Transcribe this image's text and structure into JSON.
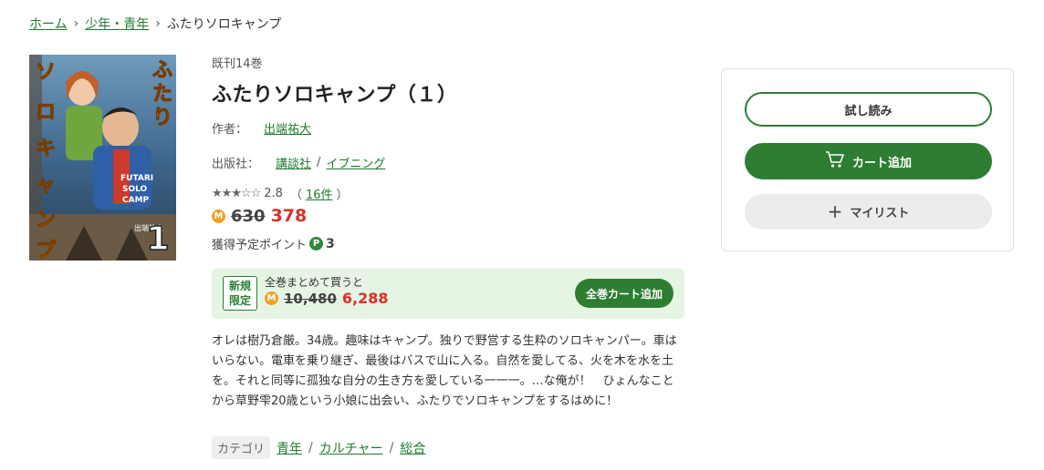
{
  "breadcrumb": {
    "items": [
      "ホーム",
      "少年・青年"
    ],
    "current": "ふたりソロキャンプ"
  },
  "cover": {
    "alt": "ふたりソロキャンプ 1 cover",
    "title_lettering": "ふたりソロキャンプ",
    "tag_lettering": "FUTARI SOLO CAMP",
    "author_lettering": "出端祐大",
    "volume_lettering": "1"
  },
  "book": {
    "volume_count": "既刊14巻",
    "title": "ふたりソロキャンプ（１）",
    "author_label": "作者：",
    "author": "出端祐大",
    "publisher_label": "出版社：",
    "publisher": "講談社",
    "imprint": "イブニング",
    "rating_stars": "★★★☆☆",
    "rating_value": "2.8",
    "review_count_text": "16件",
    "price_old": "630",
    "price_new": "378",
    "coin_letter": "M",
    "points_label": "獲得予定ポイント",
    "points_letter": "P",
    "points_value": "3"
  },
  "bundle": {
    "badge_line1": "新規",
    "badge_line2": "限定",
    "text": "全巻まとめて買うと",
    "price_old": "10,480",
    "price_new": "6,288",
    "button_label": "全巻カート追加"
  },
  "description": "オレは樹乃倉厳。34歳。趣味はキャンプ。独りで野営する生粋のソロキャンパー。車はいらない。電車を乗り継ぎ、最後はバスで山に入る。自然を愛してる、火を木を水を土を。それと同等に孤独な自分の生き方を愛している一一一。…な俺が！　ひょんなことから草野雫20歳という小娘に出会い、ふたりでソロキャンプをするはめに！",
  "category": {
    "label": "カテゴリ",
    "items": [
      "青年",
      "カルチャー",
      "総合"
    ]
  },
  "panel": {
    "trial_label": "試し読み",
    "cart_label": "カート追加",
    "mylist_label": "マイリスト"
  },
  "colors": {
    "accent_green": "#2e7d32",
    "price_red": "#d93025",
    "coin_orange": "#f0a020",
    "bundle_bg": "#e6f4e3"
  }
}
